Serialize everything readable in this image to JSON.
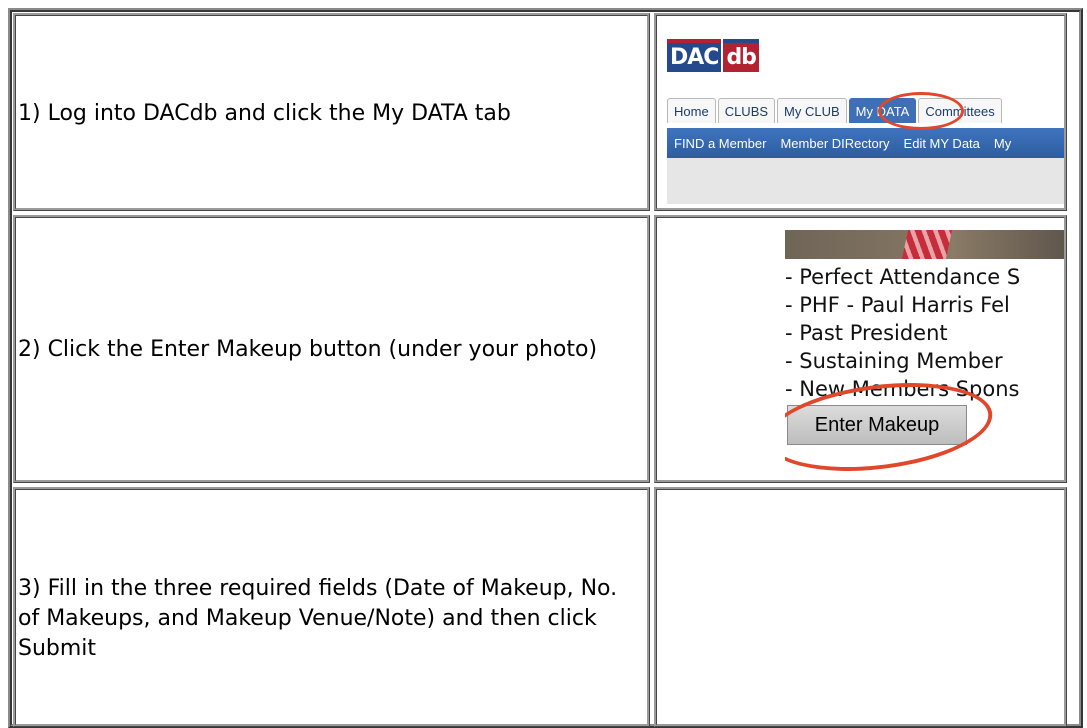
{
  "steps": [
    {
      "text": "1) Log into DACdb and click the My DATA tab"
    },
    {
      "text": "2) Click the Enter Makeup button (under your photo)"
    },
    {
      "text": "3) Fill in the three required fields (Date of Makeup, No. of Makeups, and Makeup Venue/Note) and then click Submit"
    }
  ],
  "shot1": {
    "logo_left": "DAC",
    "logo_right": "db",
    "tabs": [
      "Home",
      "CLUBS",
      "My CLUB",
      "My DATA",
      "Committees"
    ],
    "active_tab": "My DATA",
    "subnav": [
      "FIND a Member",
      "Member DIRectory",
      "Edit MY Data",
      "My"
    ],
    "brand_blue": "#254a8b",
    "brand_red": "#b22231",
    "highlight": "#e0472b"
  },
  "shot2": {
    "honors": [
      "- Perfect Attendance S",
      "- PHF - Paul Harris Fel",
      "- Past President",
      "- Sustaining Member",
      "- New Members Spons"
    ],
    "button_label": "Enter Makeup"
  }
}
